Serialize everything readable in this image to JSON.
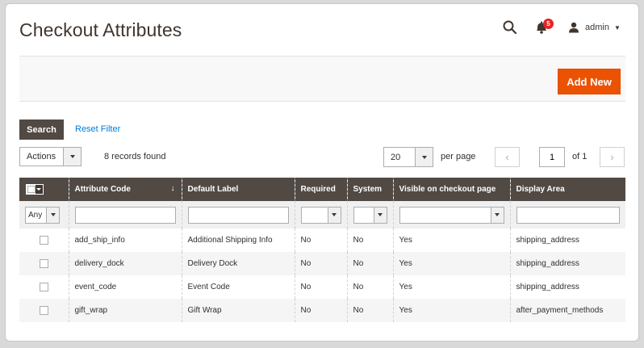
{
  "header": {
    "title": "Checkout Attributes",
    "notification_count": "5",
    "user_label": "admin"
  },
  "action_bar": {
    "add_label": "Add New"
  },
  "filters": {
    "search_label": "Search",
    "reset_label": "Reset Filter",
    "actions_value": "Actions",
    "records_text": "8 records found",
    "per_page_value": "20",
    "per_page_label": "per page",
    "page_value": "1",
    "page_total": "of 1"
  },
  "grid": {
    "columns": [
      "Attribute Code",
      "Default Label",
      "Required",
      "System",
      "Visible on checkout page",
      "Display Area"
    ],
    "filter_any": "Any",
    "rows": [
      {
        "code": "add_ship_info",
        "label": "Additional Shipping Info",
        "required": "No",
        "system": "No",
        "visible": "Yes",
        "area": "shipping_address"
      },
      {
        "code": "delivery_dock",
        "label": "Delivery Dock",
        "required": "No",
        "system": "No",
        "visible": "Yes",
        "area": "shipping_address"
      },
      {
        "code": "event_code",
        "label": "Event Code",
        "required": "No",
        "system": "No",
        "visible": "Yes",
        "area": "shipping_address"
      },
      {
        "code": "gift_wrap",
        "label": "Gift Wrap",
        "required": "No",
        "system": "No",
        "visible": "Yes",
        "area": "after_payment_methods"
      }
    ]
  },
  "colors": {
    "accent": "#eb5202",
    "header_dark": "#514943",
    "link": "#007bdb",
    "badge": "#e22626"
  }
}
